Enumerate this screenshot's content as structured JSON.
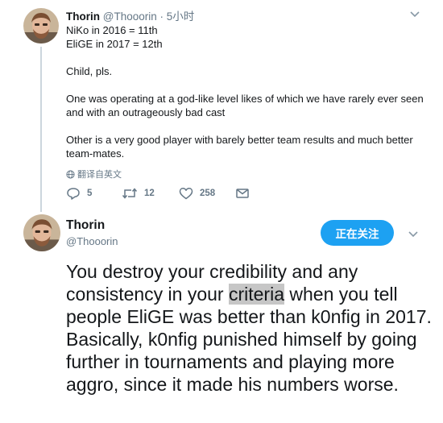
{
  "tweet1": {
    "name": "Thorin",
    "handle": "@Thooorin",
    "time": "5小时",
    "lines": [
      "NiKo in 2016 = 11th",
      "EliGE in 2017 = 12th",
      "",
      "Child, pls.",
      "",
      "One was operating at a god-like level likes of which we have rarely ever seen and with an outrageously bad cast",
      "",
      "Other is a very good player with barely better team results and much better team-mates."
    ],
    "translate_label": "翻译自英文",
    "actions": {
      "reply_count": "5",
      "retweet_count": "12",
      "like_count": "258"
    },
    "icons": [
      "globe-icon",
      "reply-icon",
      "retweet-icon",
      "like-icon",
      "message-icon",
      "chevron-down-icon"
    ]
  },
  "tweet2": {
    "name": "Thorin",
    "handle": "@Thooorin",
    "follow_label": "正在关注",
    "text_before": "You destroy your credibility and any consistency in your ",
    "text_highlight": "criteria",
    "text_after": " when you tell people EliGE was better than k0nfig in 2017.  Basically, k0nfig punished himself by going further in tournaments and playing more aggro, since it made his numbers worse."
  },
  "colors": {
    "accent": "#1da1f2",
    "muted": "#657786",
    "text": "#14171a",
    "thread_line": "#ccd6dd",
    "highlight": "#c6c6c6"
  }
}
